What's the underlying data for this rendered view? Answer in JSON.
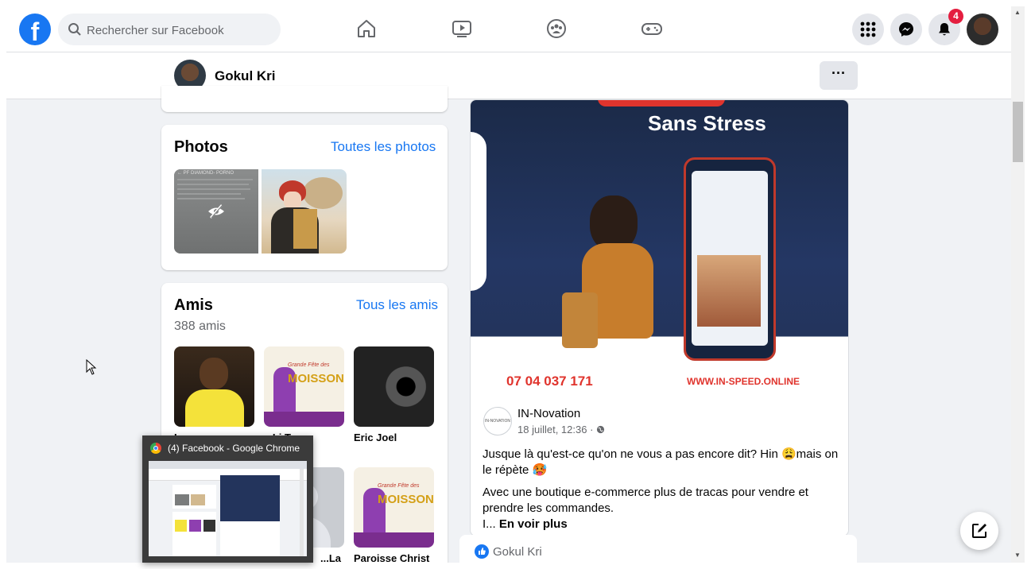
{
  "topbar": {
    "search_placeholder": "Rechercher sur Facebook",
    "notifications_count": "4",
    "brand_color": "#1877f2"
  },
  "subheader": {
    "name": "Gokul Kri",
    "more_label": "···"
  },
  "photos": {
    "title": "Photos",
    "see_all": "Toutes les photos",
    "first_thumb_text": "← PF DIAMOND- PORNO"
  },
  "friends": {
    "title": "Amis",
    "count": "388 amis",
    "see_all": "Tous les amis",
    "items": [
      {
        "name": "L..."
      },
      {
        "name": "...Li Tr..."
      },
      {
        "name": "Eric Joel"
      },
      {
        "name": "...La"
      },
      {
        "name": "Paroisse Christ"
      }
    ],
    "poster_title": "MOISSONS",
    "poster_subtitle": "Grande Fête des"
  },
  "post": {
    "image_headline": "Sans Stress",
    "image_phone": "07 04 037 171",
    "image_site": "WWW.IN-SPEED.ONLINE",
    "author": "IN-Novation",
    "time": "18 juillet, 12:36 · ",
    "text1": "Jusque là qu'est-ce qu'on ne vous a pas encore dit? Hin 😩mais on le répète 🥵",
    "text2": "Avec une boutique e-commerce plus de tracas pour vendre et prendre les commandes.",
    "text3": "I... ",
    "see_more": "En voir plus"
  },
  "footer": {
    "liker": "Gokul Kri"
  },
  "popup": {
    "title": "(4) Facebook - Google Chrome"
  }
}
